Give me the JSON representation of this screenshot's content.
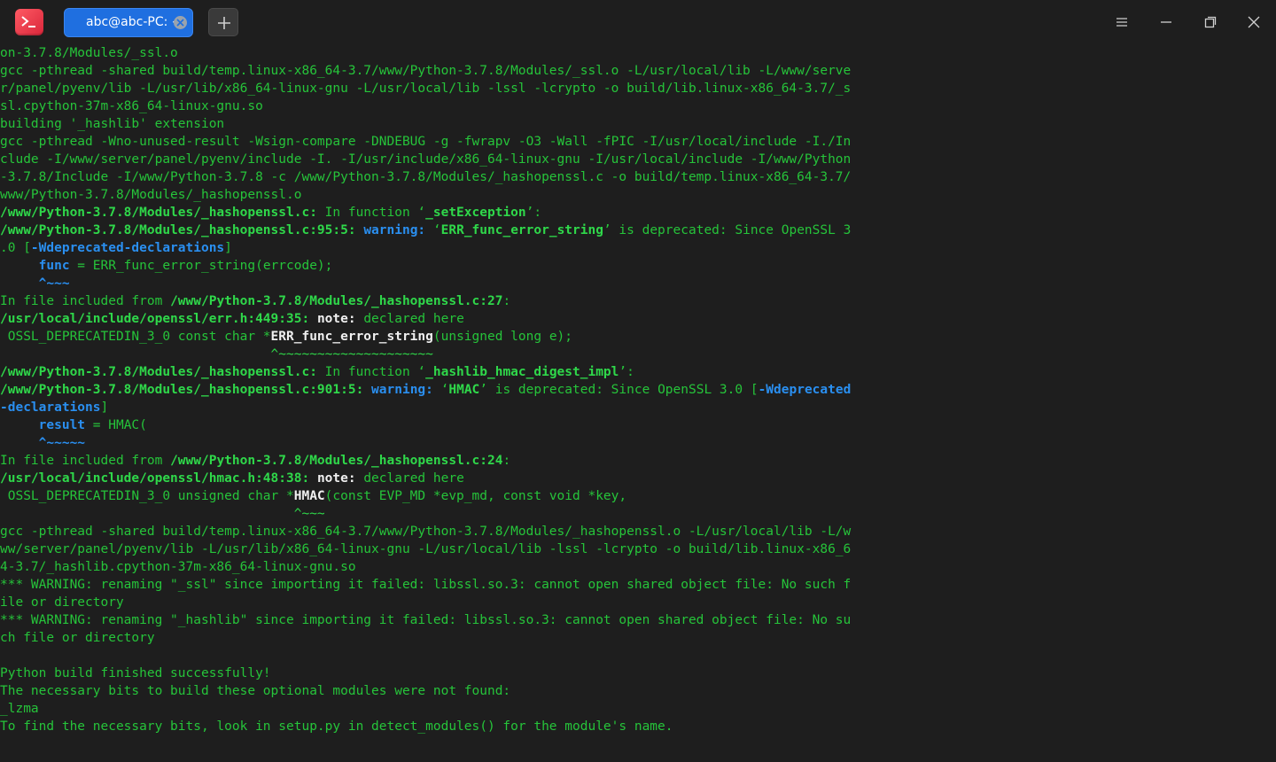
{
  "window": {
    "tab_title": "abc@abc-PC: ~"
  },
  "icons": {
    "app": "terminal-app-icon",
    "tab_close": "close-icon",
    "new_tab": "plus-icon",
    "menu": "hamburger-menu-icon",
    "minimize": "minimize-icon",
    "maximize": "maximize-icon",
    "close": "close-icon"
  },
  "colors": {
    "background": "#1e1e1e",
    "text_green": "#26c43a",
    "bold_green": "#2fd84a",
    "blue": "#2a8ff0",
    "tab_active": "#1f6fe0",
    "app_icon": "#e3303f"
  },
  "terminal": {
    "l01": "on-3.7.8/Modules/_ssl.o",
    "l02": "gcc -pthread -shared build/temp.linux-x86_64-3.7/www/Python-3.7.8/Modules/_ssl.o -L/usr/local/lib -L/www/serve",
    "l03": "r/panel/pyenv/lib -L/usr/lib/x86_64-linux-gnu -L/usr/local/lib -lssl -lcrypto -o build/lib.linux-x86_64-3.7/_s",
    "l04": "sl.cpython-37m-x86_64-linux-gnu.so",
    "l05": "building '_hashlib' extension",
    "l06": "gcc -pthread -Wno-unused-result -Wsign-compare -DNDEBUG -g -fwrapv -O3 -Wall -fPIC -I/usr/local/include -I./In",
    "l07": "clude -I/www/server/panel/pyenv/include -I. -I/usr/include/x86_64-linux-gnu -I/usr/local/include -I/www/Python",
    "l08": "-3.7.8/Include -I/www/Python-3.7.8 -c /www/Python-3.7.8/Modules/_hashopenssl.c -o build/temp.linux-x86_64-3.7/",
    "l09": "www/Python-3.7.8/Modules/_hashopenssl.o",
    "l10": {
      "a": "/www/Python-3.7.8/Modules/_hashopenssl.c:",
      "b": " In function ‘",
      "c": "_setException",
      "d": "’:"
    },
    "l11": {
      "a": "/www/Python-3.7.8/Modules/_hashopenssl.c:95:5:",
      "b": " ",
      "c": "warning:",
      "d": " ‘",
      "e": "ERR_func_error_string",
      "f": "’ is deprecated: Since OpenSSL 3"
    },
    "l12": {
      "a": ".0 [",
      "b": "-Wdeprecated-declarations",
      "c": "]"
    },
    "l13": {
      "a": "     ",
      "b": "func",
      "c": " = ERR_func_error_string(errcode);"
    },
    "l14": {
      "a": "     ",
      "b": "^~~~"
    },
    "l15": {
      "a": "In file included from ",
      "b": "/www/Python-3.7.8/Modules/_hashopenssl.c:27",
      "c": ":"
    },
    "l16": {
      "a": "/usr/local/include/openssl/err.h:449:35:",
      "b": " ",
      "c": "note:",
      "d": " declared here"
    },
    "l17": {
      "a": " OSSL_DEPRECATEDIN_3_0 const char *",
      "b": "ERR_func_error_string",
      "c": "(unsigned long e);"
    },
    "l18": {
      "a": "                                   ",
      "b": "^~~~~~~~~~~~~~~~~~~~~"
    },
    "l19": {
      "a": "/www/Python-3.7.8/Modules/_hashopenssl.c:",
      "b": " In function ‘",
      "c": "_hashlib_hmac_digest_impl",
      "d": "’:"
    },
    "l20": {
      "a": "/www/Python-3.7.8/Modules/_hashopenssl.c:901:5:",
      "b": " ",
      "c": "warning:",
      "d": " ‘",
      "e": "HMAC",
      "f": "’ is deprecated: Since OpenSSL 3.0 [",
      "g": "-Wdeprecated"
    },
    "l21": {
      "a": "-declarations",
      "b": "]"
    },
    "l22": {
      "a": "     ",
      "b": "result",
      "c": " = HMAC("
    },
    "l23": {
      "a": "     ",
      "b": "^~~~~~"
    },
    "l24": {
      "a": "In file included from ",
      "b": "/www/Python-3.7.8/Modules/_hashopenssl.c:24",
      "c": ":"
    },
    "l25": {
      "a": "/usr/local/include/openssl/hmac.h:48:38:",
      "b": " ",
      "c": "note:",
      "d": " declared here"
    },
    "l26": {
      "a": " OSSL_DEPRECATEDIN_3_0 unsigned char *",
      "b": "HMAC",
      "c": "(const EVP_MD *evp_md, const void *key,"
    },
    "l27": {
      "a": "                                      ",
      "b": "^~~~"
    },
    "l28": "gcc -pthread -shared build/temp.linux-x86_64-3.7/www/Python-3.7.8/Modules/_hashopenssl.o -L/usr/local/lib -L/w",
    "l29": "ww/server/panel/pyenv/lib -L/usr/lib/x86_64-linux-gnu -L/usr/local/lib -lssl -lcrypto -o build/lib.linux-x86_6",
    "l30": "4-3.7/_hashlib.cpython-37m-x86_64-linux-gnu.so",
    "l31": "*** WARNING: renaming \"_ssl\" since importing it failed: libssl.so.3: cannot open shared object file: No such f",
    "l32": "ile or directory",
    "l33": "*** WARNING: renaming \"_hashlib\" since importing it failed: libssl.so.3: cannot open shared object file: No su",
    "l34": "ch file or directory",
    "l35": "",
    "l36": "Python build finished successfully!",
    "l37": "The necessary bits to build these optional modules were not found:",
    "l38": "_lzma",
    "l39": "To find the necessary bits, look in setup.py in detect_modules() for the module's name."
  }
}
